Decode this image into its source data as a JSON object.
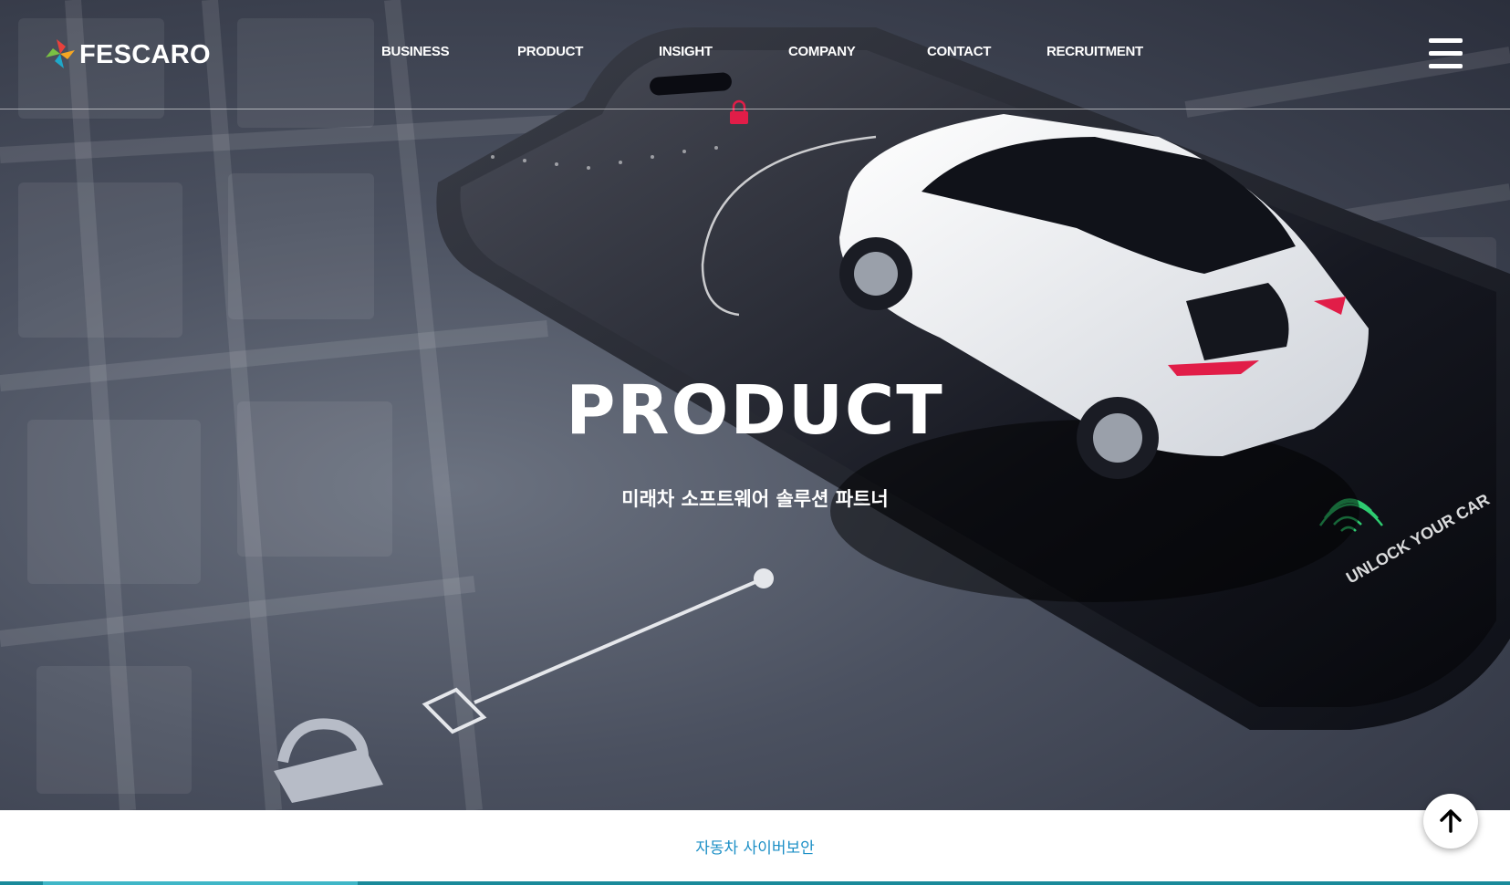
{
  "brand": {
    "name": "FESCARO"
  },
  "nav": {
    "items": [
      {
        "label": "BUSINESS"
      },
      {
        "label": "PRODUCT"
      },
      {
        "label": "INSIGHT"
      },
      {
        "label": "COMPANY"
      },
      {
        "label": "CONTACT"
      },
      {
        "label": "RECRUITMENT"
      }
    ],
    "menu_icon": "hamburger-icon"
  },
  "hero": {
    "title": "PRODUCT",
    "subtitle": "미래차 소프트웨어 솔루션 파트너",
    "image_text": "UNLOCK YOUR CAR"
  },
  "tabs": {
    "active_label": "자동차 사이버보안"
  },
  "scroll_top": {
    "icon": "arrow-up-icon"
  },
  "colors": {
    "accent": "#1b8fc6",
    "tab_line": "#1a8a9a",
    "fingerprint": "#2ecc71",
    "brake_light": "#e11d48"
  }
}
